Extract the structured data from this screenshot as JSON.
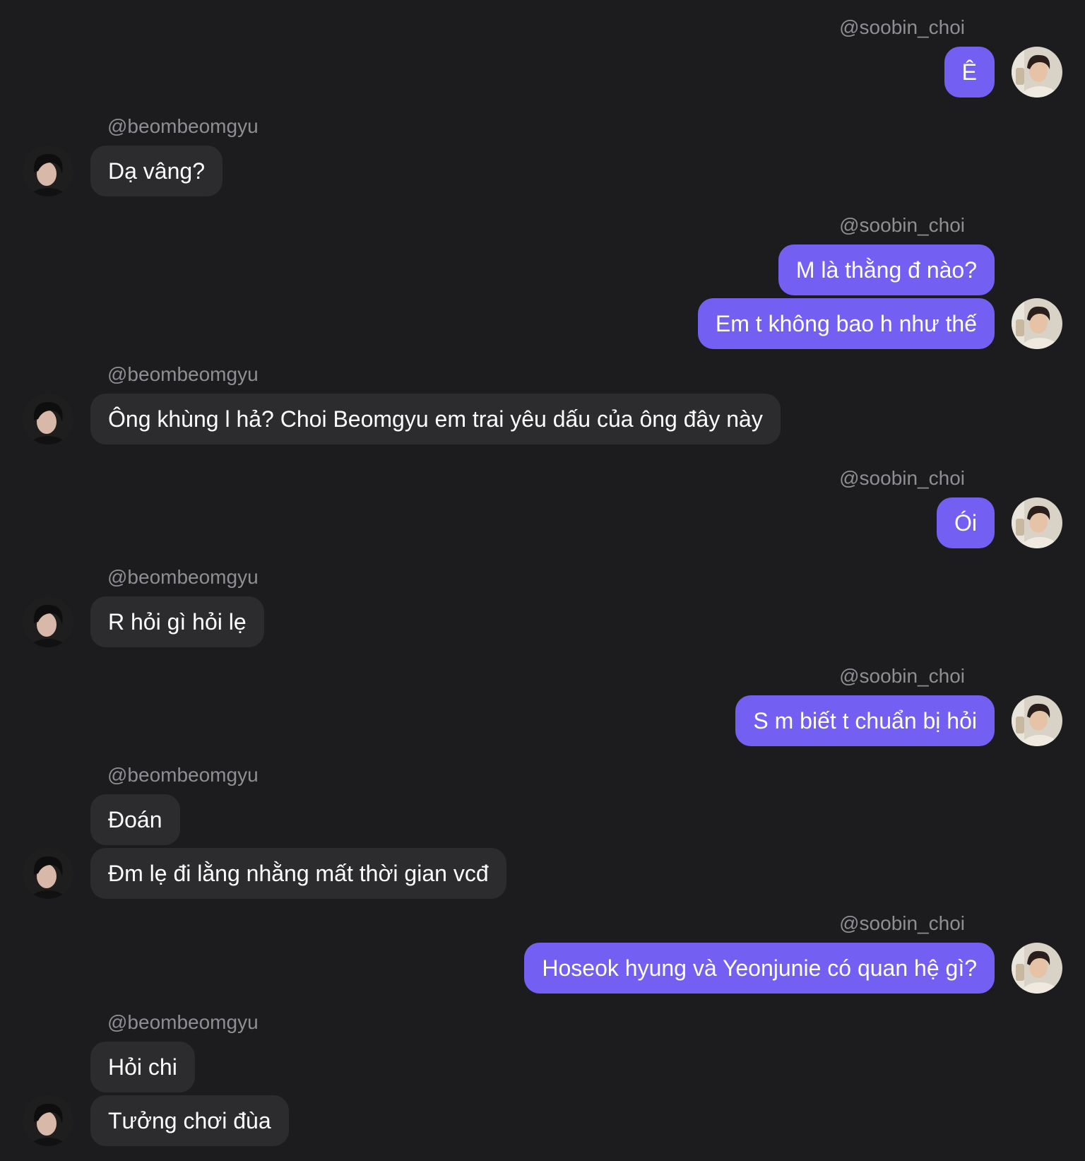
{
  "users": {
    "self": {
      "handle": "@soobin_choi",
      "avatar_icon": "soobin-avatar"
    },
    "other": {
      "handle": "@beombeomgyu",
      "avatar_icon": "beomgyu-avatar"
    }
  },
  "colors": {
    "background": "#1c1c1e",
    "outgoing_bubble": "#7360f2",
    "incoming_bubble": "#2c2c2e",
    "username": "#8e8e93",
    "text": "#ffffff"
  },
  "messages": [
    {
      "sender": "@soobin_choi",
      "direction": "outgoing",
      "bubbles": [
        "Ê"
      ]
    },
    {
      "sender": "@beombeomgyu",
      "direction": "incoming",
      "bubbles": [
        "Dạ vâng?"
      ]
    },
    {
      "sender": "@soobin_choi",
      "direction": "outgoing",
      "bubbles": [
        "M là thằng đ nào?",
        "Em t không bao h như thế"
      ]
    },
    {
      "sender": "@beombeomgyu",
      "direction": "incoming",
      "bubbles": [
        "Ông khùng l hả? Choi Beomgyu em trai yêu dấu của ông đây này"
      ]
    },
    {
      "sender": "@soobin_choi",
      "direction": "outgoing",
      "bubbles": [
        "Ói"
      ]
    },
    {
      "sender": "@beombeomgyu",
      "direction": "incoming",
      "bubbles": [
        "R hỏi gì hỏi lẹ"
      ]
    },
    {
      "sender": "@soobin_choi",
      "direction": "outgoing",
      "bubbles": [
        "S m biết t chuẩn bị hỏi"
      ]
    },
    {
      "sender": "@beombeomgyu",
      "direction": "incoming",
      "bubbles": [
        "Đoán",
        "Đm lẹ đi lằng nhằng mất thời gian vcđ"
      ]
    },
    {
      "sender": "@soobin_choi",
      "direction": "outgoing",
      "bubbles": [
        "Hoseok hyung và Yeonjunie có quan hệ gì?"
      ]
    },
    {
      "sender": "@beombeomgyu",
      "direction": "incoming",
      "bubbles": [
        "Hỏi chi",
        "Tưởng chơi đùa"
      ]
    }
  ]
}
